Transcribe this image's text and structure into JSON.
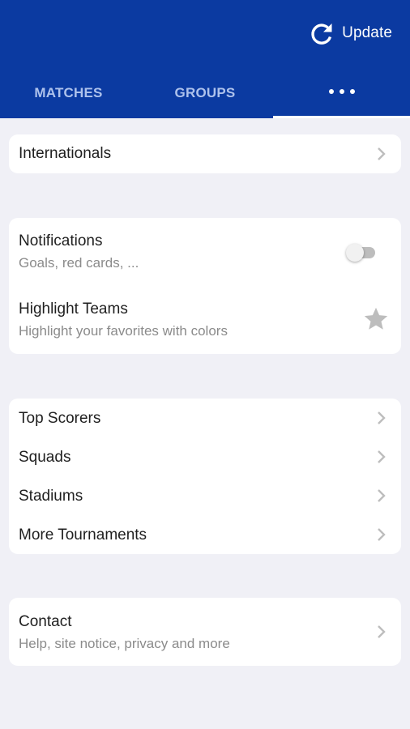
{
  "app": {
    "update_label": "Update",
    "update_icon": "refresh-icon",
    "colors": {
      "header": "#0b3aa1",
      "tab_inactive": "#aec2ec",
      "tab_active": "#ffffff",
      "background": "#f0f0f6",
      "card": "#ffffff",
      "subtitle": "#8b8b8b",
      "icon_gray": "#bdbdbd"
    }
  },
  "tabs": [
    {
      "label": "MATCHES",
      "selected": false
    },
    {
      "label": "GROUPS",
      "selected": false
    },
    {
      "label": "",
      "icon": "more-horizontal-icon",
      "selected": true
    }
  ],
  "section_internationals": {
    "items": [
      {
        "title": "Internationals",
        "icon": "chevron-right-icon"
      }
    ]
  },
  "section_settings": {
    "notifications": {
      "title": "Notifications",
      "subtitle": "Goals, red cards, ...",
      "toggle_on": false
    },
    "highlight": {
      "title": "Highlight Teams",
      "subtitle": "Highlight your favorites with colors",
      "icon": "star-icon"
    }
  },
  "section_lists": {
    "items": [
      {
        "title": "Top Scorers",
        "icon": "chevron-right-icon"
      },
      {
        "title": "Squads",
        "icon": "chevron-right-icon"
      },
      {
        "title": "Stadiums",
        "icon": "chevron-right-icon"
      },
      {
        "title": "More Tournaments",
        "icon": "chevron-right-icon"
      }
    ]
  },
  "section_contact": {
    "title": "Contact",
    "subtitle": "Help, site notice, privacy and more",
    "icon": "chevron-right-icon"
  }
}
